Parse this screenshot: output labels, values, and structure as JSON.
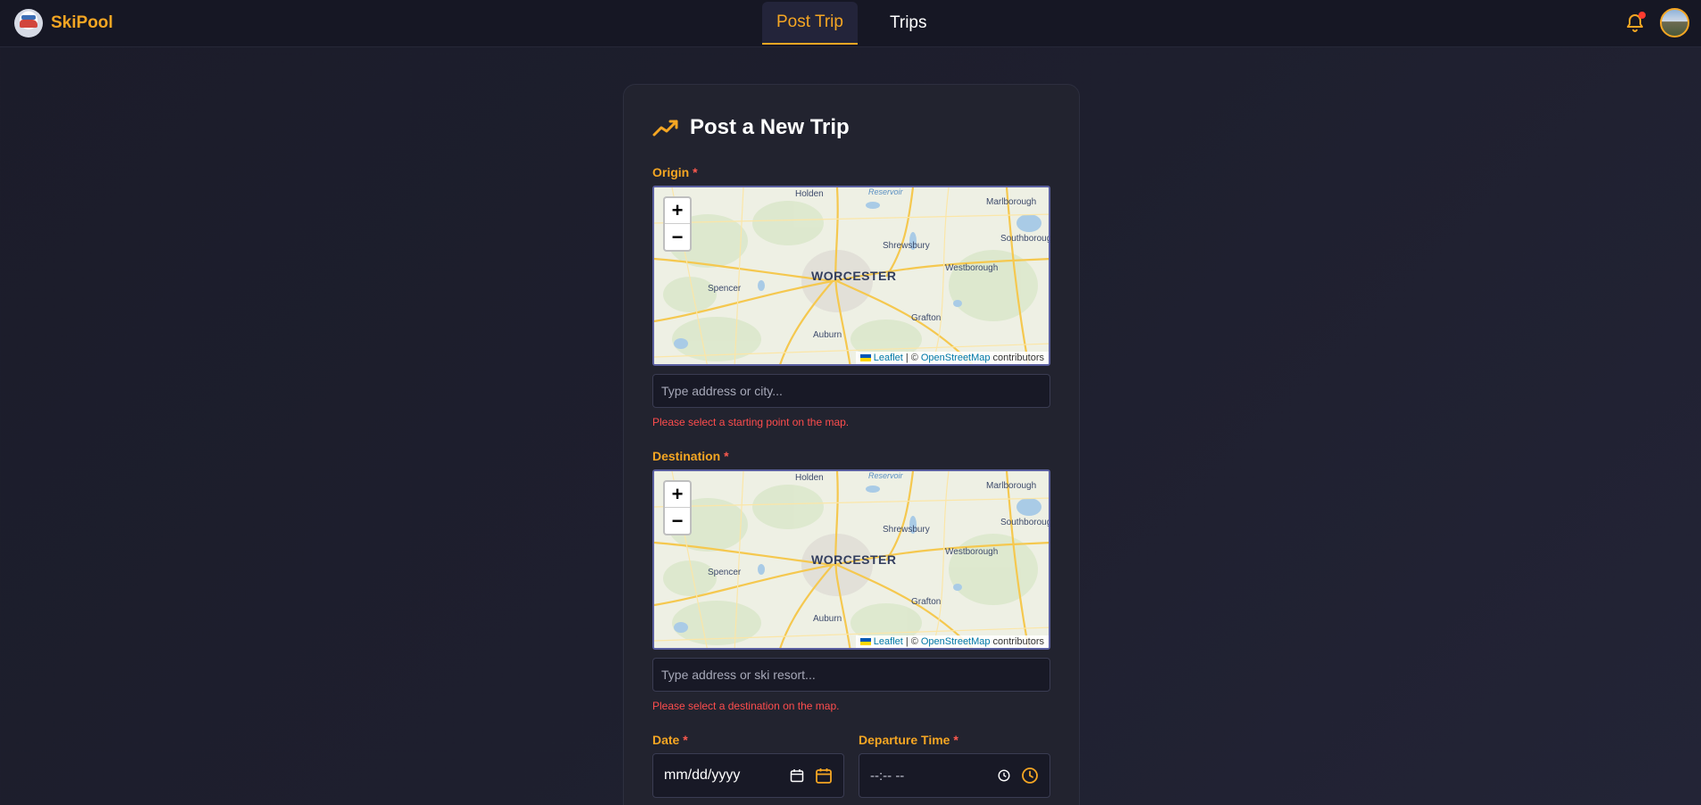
{
  "app": {
    "name": "SkiPool"
  },
  "nav": {
    "tabs": [
      {
        "label": "Post Trip",
        "active": true
      },
      {
        "label": "Trips",
        "active": false
      }
    ],
    "notification_dot": true
  },
  "form": {
    "title": "Post a New Trip",
    "origin": {
      "label": "Origin",
      "required_mark": "*",
      "placeholder": "Type address or city...",
      "error": "Please select a starting point on the map."
    },
    "destination": {
      "label": "Destination",
      "required_mark": "*",
      "placeholder": "Type address or ski resort...",
      "error": "Please select a destination on the map."
    },
    "date": {
      "label": "Date",
      "required_mark": "*",
      "placeholder": "mm/dd/yyyy"
    },
    "time": {
      "label": "Departure Time",
      "required_mark": "*",
      "placeholder": "--:-- --"
    }
  },
  "map": {
    "zoom_in": "+",
    "zoom_out": "−",
    "attribution": {
      "leaflet": "Leaflet",
      "sep": "| ©",
      "osm": "OpenStreetMap",
      "suffix": "contributors"
    },
    "labels": {
      "holden": "Holden",
      "reservoir": "Reservoir",
      "marlborough": "Marlborough",
      "southborough": "Southborough",
      "shrewsbury": "Shrewsbury",
      "westborough": "Westborough",
      "worcester": "WORCESTER",
      "spencer": "Spencer",
      "grafton": "Grafton",
      "auburn": "Auburn"
    }
  },
  "colors": {
    "accent": "#f5a623",
    "error": "#ff4d4d",
    "bg": "#1e1f2e",
    "card": "#22232f"
  }
}
